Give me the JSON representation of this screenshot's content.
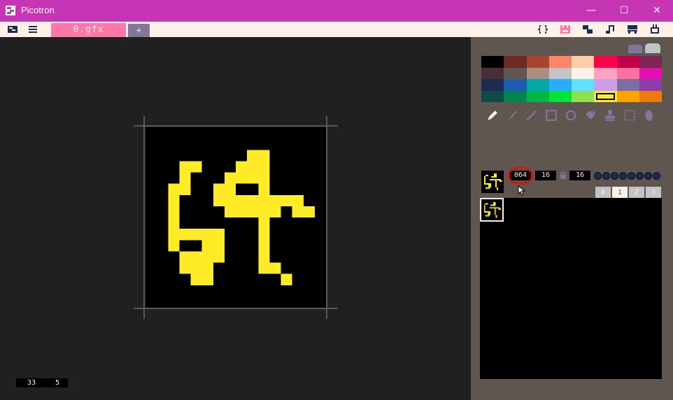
{
  "window": {
    "title": "Picotron",
    "icons": [
      "picotron-logo-icon",
      "minimize-icon",
      "maximize-icon",
      "close-icon"
    ],
    "minimize_glyph": "—",
    "maximize_glyph": "☐",
    "close_glyph": "✕"
  },
  "toolbar": {
    "file_tab": "0.gfx",
    "new_tab": "+",
    "left_icons": [
      "picotron-menu-icon",
      "hamburger-menu-icon"
    ],
    "right_icons": [
      "code-editor-icon",
      "sprite-editor-icon",
      "map-editor-icon",
      "sfx-editor-icon",
      "music-editor-icon",
      "export-icon"
    ]
  },
  "status": {
    "x": "33",
    "y": "5"
  },
  "sprite_editor": {
    "index": "064",
    "width": "16",
    "height": "16",
    "flag_count": 8,
    "banks": [
      "0",
      "1",
      "2",
      "3"
    ],
    "active_bank": "1"
  },
  "palette": {
    "colors": [
      "#000000",
      "#6b2b22",
      "#a8452f",
      "#ff8366",
      "#ffccaa",
      "#ff004d",
      "#c10047",
      "#7e2553",
      "#4a2f38",
      "#5f574f",
      "#ab8e7f",
      "#c2c3c7",
      "#fff1e8",
      "#ffa1c0",
      "#ff6f9f",
      "#e60eb3",
      "#1d2b53",
      "#1f5cb0",
      "#00a8a6",
      "#29adff",
      "#61e2ff",
      "#c9a0ea",
      "#7a6fa0",
      "#8b3fa6",
      "#10494a",
      "#008751",
      "#00b543",
      "#00e436",
      "#8ee04f",
      "#ffec27",
      "#ffa300",
      "#f07a0b"
    ],
    "selected": 29
  },
  "tools": [
    "pencil-icon",
    "brush-icon",
    "line-icon",
    "rectangle-icon",
    "circle-icon",
    "fill-bucket-icon",
    "stamp-icon",
    "selection-icon",
    "hand-pan-icon"
  ],
  "colors": {
    "accent": "#c535b4",
    "sprite_color": "#ffec27",
    "tab_pink": "#ff77a8",
    "panel": "#5f574f"
  }
}
